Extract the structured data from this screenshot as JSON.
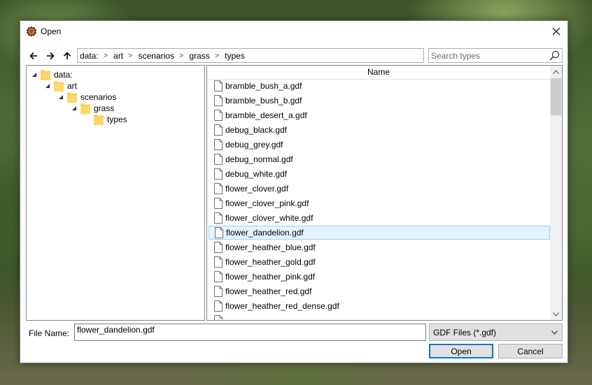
{
  "window": {
    "title": "Open",
    "app_icon": "gear-shield-icon",
    "close_icon": "close-icon"
  },
  "navigation": {
    "back_icon": "arrow-left-icon",
    "forward_icon": "arrow-right-icon",
    "up_icon": "arrow-up-icon",
    "breadcrumb": [
      "data:",
      "art",
      "scenarios",
      "grass",
      "types"
    ],
    "search_placeholder": "Search types",
    "search_icon": "search-icon"
  },
  "tree": {
    "nodes": [
      {
        "label": "data:",
        "depth": 0,
        "expanded": true
      },
      {
        "label": "art",
        "depth": 1,
        "expanded": true
      },
      {
        "label": "scenarios",
        "depth": 2,
        "expanded": true
      },
      {
        "label": "grass",
        "depth": 3,
        "expanded": true
      },
      {
        "label": "types",
        "depth": 4,
        "expanded": false
      }
    ]
  },
  "files": {
    "column_header": "Name",
    "items": [
      "bramble_bush_a.gdf",
      "bramble_bush_b.gdf",
      "bramble_desert_a.gdf",
      "debug_black.gdf",
      "debug_grey.gdf",
      "debug_normal.gdf",
      "debug_white.gdf",
      "flower_clover.gdf",
      "flower_clover_pink.gdf",
      "flower_clover_white.gdf",
      "flower_dandelion.gdf",
      "flower_heather_blue.gdf",
      "flower_heather_gold.gdf",
      "flower_heather_pink.gdf",
      "flower_heather_red.gdf",
      "flower_heather_red_dense.gdf"
    ],
    "selected": "flower_dandelion.gdf"
  },
  "footer": {
    "file_name_label": "File Name:",
    "file_name_value": "flower_dandelion.gdf",
    "file_type": "GDF Files (*.gdf)",
    "open_label": "Open",
    "cancel_label": "Cancel"
  },
  "colors": {
    "selection_bg": "#e5f3ff",
    "selection_border": "#99d1ff",
    "accent": "#0078d7",
    "folder": "#ffd767"
  }
}
